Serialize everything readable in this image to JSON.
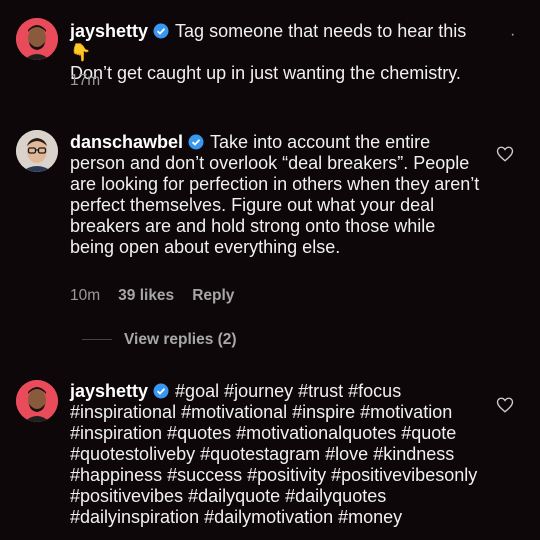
{
  "comments": [
    {
      "username": "jayshetty",
      "text": "Tag someone that needs to hear this",
      "emoji": "👇",
      "text2": "Don’t get caught up in just wanting the chemistry.",
      "time": "17m"
    },
    {
      "username": "danschawbel",
      "text": "Take into account the entire person and don’t overlook “deal breakers”. People are looking for perfection in others when they aren’t perfect themselves. Figure out what your deal breakers are and hold strong onto those while being open about everything else.",
      "time": "10m",
      "likes": "39 likes",
      "reply": "Reply",
      "view_replies": "View replies (2)"
    },
    {
      "username": "jayshetty",
      "text": "#goal #journey #trust #focus #inspirational #motivational #inspire #motivation #inspiration #quotes #motivationalquotes #quote #quotestoliveby #quotestagram #love #kindness #happiness #success #positivity #positivevibesonly #positivevibes #dailyquote #dailyquotes #dailyinspiration #dailymotivation #money"
    }
  ],
  "icons": {
    "verified": "verified-badge-icon",
    "heart": "heart-outline-icon",
    "more": "more-dots-icon"
  },
  "colors": {
    "background": "#0d0709",
    "verified_blue": "#3897f0",
    "avatar_bg": "#e94b5b"
  }
}
